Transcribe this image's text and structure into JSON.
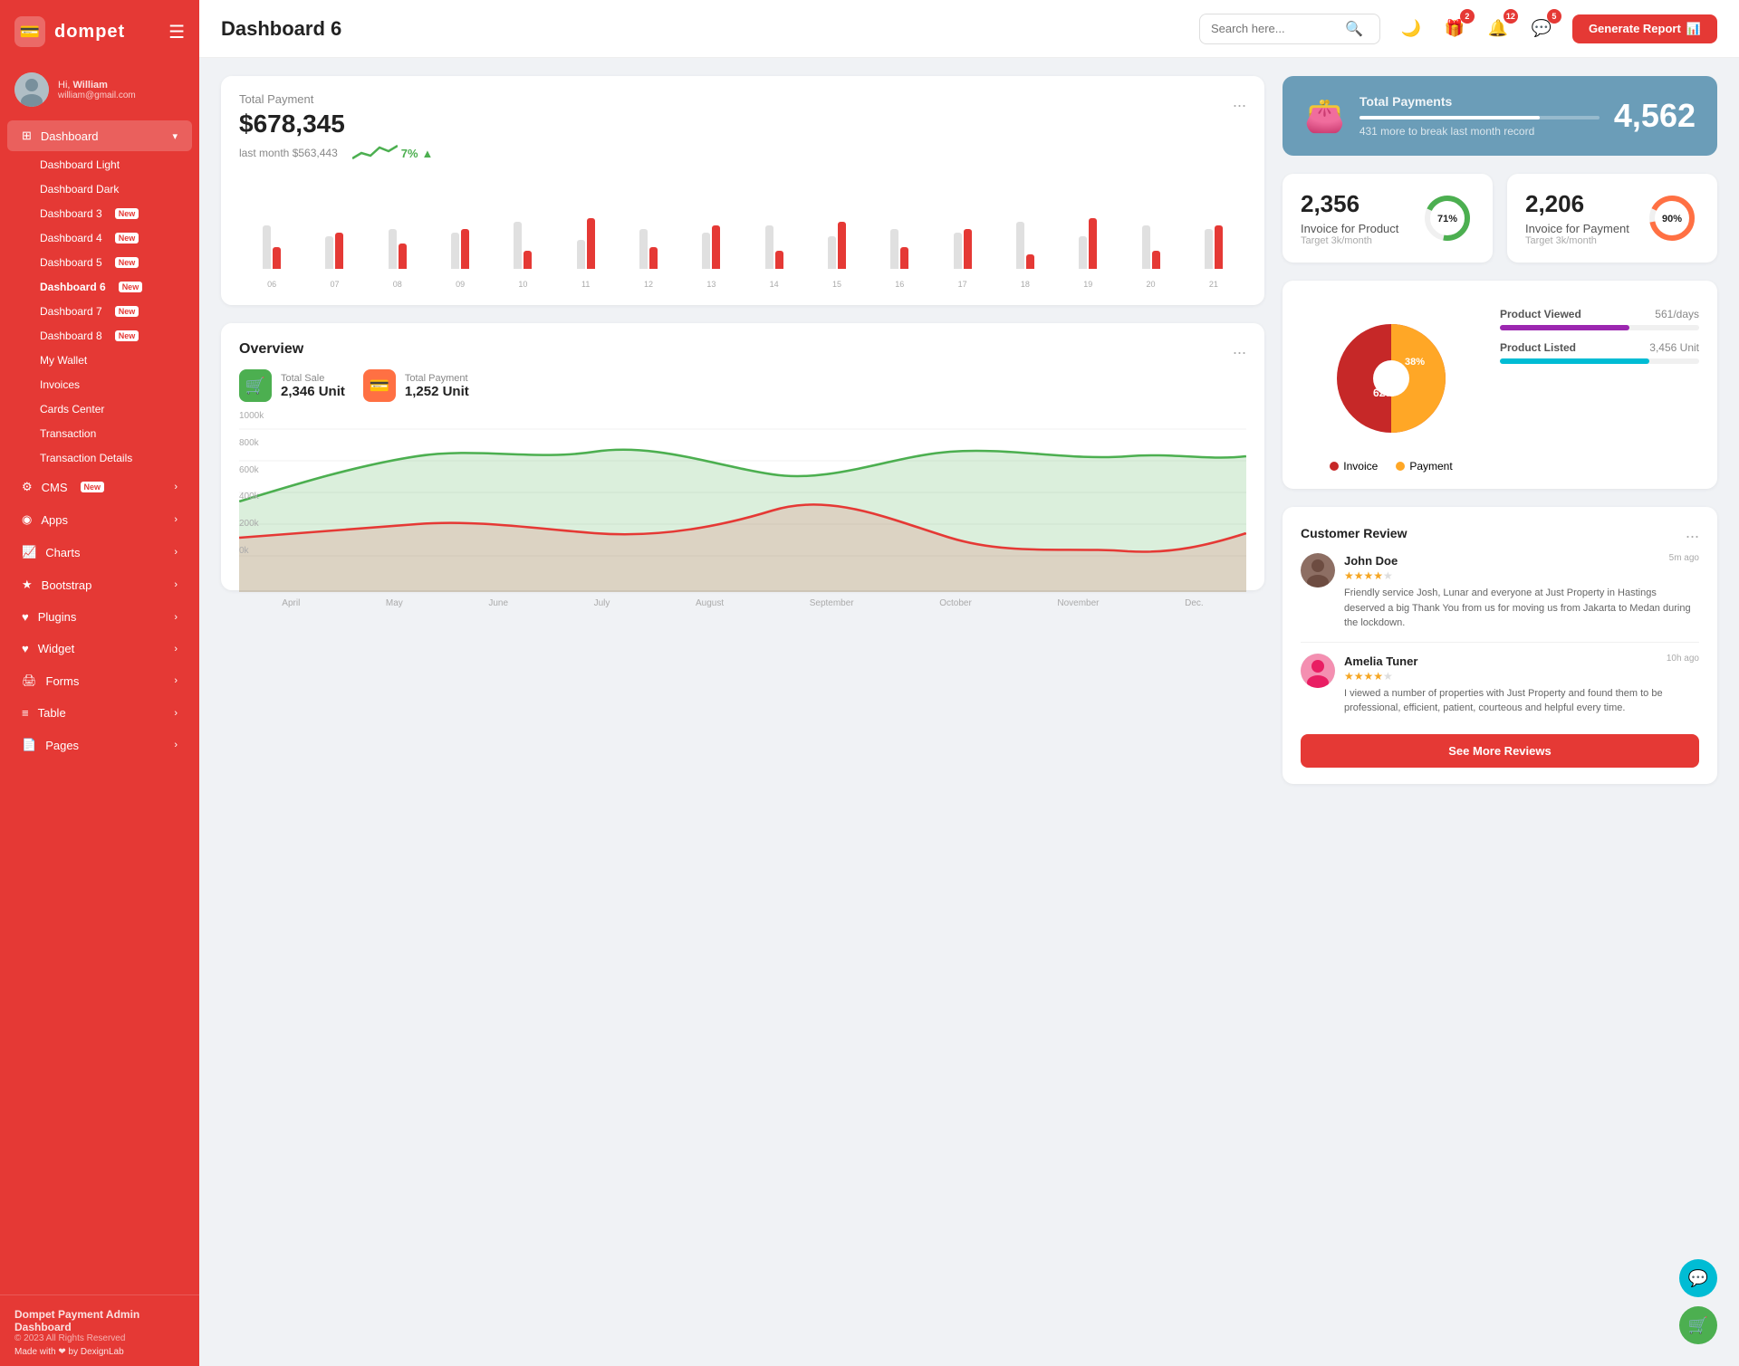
{
  "sidebar": {
    "logo": "dompet",
    "logoIcon": "💳",
    "user": {
      "greeting": "Hi,",
      "name": "William",
      "email": "william@gmail.com"
    },
    "menu": [
      {
        "id": "dashboard",
        "label": "Dashboard",
        "icon": "⊞",
        "hasArrow": true,
        "active": true
      },
      {
        "id": "dashboard-light",
        "label": "Dashboard Light",
        "sub": true
      },
      {
        "id": "dashboard-dark",
        "label": "Dashboard Dark",
        "sub": true
      },
      {
        "id": "dashboard-3",
        "label": "Dashboard 3",
        "sub": true,
        "badge": "New"
      },
      {
        "id": "dashboard-4",
        "label": "Dashboard 4",
        "sub": true,
        "badge": "New"
      },
      {
        "id": "dashboard-5",
        "label": "Dashboard 5",
        "sub": true,
        "badge": "New"
      },
      {
        "id": "dashboard-6",
        "label": "Dashboard 6",
        "sub": true,
        "badge": "New",
        "activeSub": true
      },
      {
        "id": "dashboard-7",
        "label": "Dashboard 7",
        "sub": true,
        "badge": "New"
      },
      {
        "id": "dashboard-8",
        "label": "Dashboard 8",
        "sub": true,
        "badge": "New"
      },
      {
        "id": "my-wallet",
        "label": "My Wallet",
        "sub": true
      },
      {
        "id": "invoices",
        "label": "Invoices",
        "sub": true
      },
      {
        "id": "cards-center",
        "label": "Cards Center",
        "sub": true
      },
      {
        "id": "transaction",
        "label": "Transaction",
        "sub": true
      },
      {
        "id": "transaction-details",
        "label": "Transaction Details",
        "sub": true
      },
      {
        "id": "cms",
        "label": "CMS",
        "icon": "⚙",
        "hasArrow": true,
        "badge": "New"
      },
      {
        "id": "apps",
        "label": "Apps",
        "icon": "◉",
        "hasArrow": true
      },
      {
        "id": "charts",
        "label": "Charts",
        "icon": "📈",
        "hasArrow": true
      },
      {
        "id": "bootstrap",
        "label": "Bootstrap",
        "icon": "★",
        "hasArrow": true
      },
      {
        "id": "plugins",
        "label": "Plugins",
        "icon": "♥",
        "hasArrow": true
      },
      {
        "id": "widget",
        "label": "Widget",
        "icon": "♥",
        "hasArrow": true
      },
      {
        "id": "forms",
        "label": "Forms",
        "icon": "🖨",
        "hasArrow": true
      },
      {
        "id": "table",
        "label": "Table",
        "icon": "≡",
        "hasArrow": true
      },
      {
        "id": "pages",
        "label": "Pages",
        "icon": "📄",
        "hasArrow": true
      }
    ],
    "footer": {
      "title": "Dompet Payment Admin Dashboard",
      "copyright": "© 2023 All Rights Reserved",
      "made": "Made with ❤ by DexignLab"
    }
  },
  "header": {
    "title": "Dashboard 6",
    "search": {
      "placeholder": "Search here..."
    },
    "icons": [
      {
        "id": "moon",
        "symbol": "🌙",
        "badge": null
      },
      {
        "id": "gift",
        "symbol": "🎁",
        "badge": "2"
      },
      {
        "id": "bell",
        "symbol": "🔔",
        "badge": "12"
      },
      {
        "id": "chat",
        "symbol": "💬",
        "badge": "5"
      }
    ],
    "generateBtn": "Generate Report"
  },
  "totalPayment": {
    "label": "Total Payment",
    "amount": "$678,345",
    "lastMonth": "last month $563,443",
    "trend": "7%",
    "trendUp": true,
    "dotsLabel": "..."
  },
  "barChart": {
    "labels": [
      "06",
      "07",
      "08",
      "09",
      "10",
      "11",
      "12",
      "13",
      "14",
      "15",
      "16",
      "17",
      "18",
      "19",
      "20",
      "21"
    ],
    "grayBars": [
      60,
      45,
      55,
      50,
      65,
      40,
      55,
      50,
      60,
      45,
      55,
      50,
      65,
      45,
      60,
      55
    ],
    "redBars": [
      30,
      50,
      35,
      55,
      25,
      70,
      30,
      60,
      25,
      65,
      30,
      55,
      20,
      70,
      25,
      60
    ]
  },
  "overview": {
    "title": "Overview",
    "totalSale": {
      "label": "Total Sale",
      "value": "2,346 Unit"
    },
    "totalPayment": {
      "label": "Total Payment",
      "value": "1,252 Unit"
    },
    "yLabels": [
      "1000k",
      "800k",
      "600k",
      "400k",
      "200k",
      "0k"
    ],
    "xLabels": [
      "April",
      "May",
      "June",
      "July",
      "August",
      "September",
      "October",
      "November",
      "Dec."
    ]
  },
  "totalPayments": {
    "title": "Total Payments",
    "subtitle": "431 more to break last month record",
    "count": "4,562",
    "progressWidth": "75%"
  },
  "invoiceProduct": {
    "number": "2,356",
    "label": "Invoice for Product",
    "target": "Target 3k/month",
    "percent": 71,
    "color": "#4caf50"
  },
  "invoicePayment": {
    "number": "2,206",
    "label": "Invoice for Payment",
    "target": "Target 3k/month",
    "percent": 90,
    "color": "#ff7043"
  },
  "pieChart": {
    "invoice": 62,
    "payment": 38,
    "invoiceColor": "#c62828",
    "paymentColor": "#ffa726",
    "invoiceLabel": "Invoice",
    "paymentLabel": "Payment"
  },
  "productStats": [
    {
      "label": "Product Viewed",
      "value": "561/days",
      "percent": 65,
      "color": "purple"
    },
    {
      "label": "Product Listed",
      "value": "3,456 Unit",
      "percent": 75,
      "color": "teal"
    }
  ],
  "customerReview": {
    "title": "Customer Review",
    "reviews": [
      {
        "name": "John Doe",
        "time": "5m ago",
        "stars": 4,
        "text": "Friendly service Josh, Lunar and everyone at Just Property in Hastings deserved a big Thank You from us for moving us from Jakarta to Medan during the lockdown."
      },
      {
        "name": "Amelia Tuner",
        "time": "10h ago",
        "stars": 4,
        "text": "I viewed a number of properties with Just Property and found them to be professional, efficient, patient, courteous and helpful every time."
      }
    ],
    "seeMoreBtn": "See More Reviews"
  }
}
